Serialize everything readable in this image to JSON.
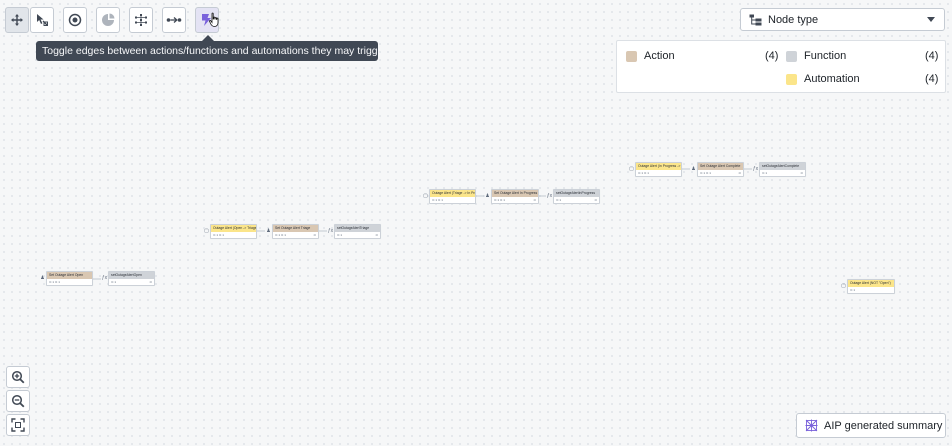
{
  "toolbar": {
    "tooltip": "Toggle edges between actions/functions and automations they may trigger"
  },
  "node_type_dropdown": {
    "label": "Node type"
  },
  "legend": {
    "items": [
      {
        "label": "Action",
        "count": "(4)",
        "color": "#d9c7b2"
      },
      {
        "label": "Function",
        "count": "(4)",
        "color": "#cfd3d8"
      },
      {
        "label": "Automation",
        "count": "(4)",
        "color": "#fbe58a"
      }
    ]
  },
  "summary_button": {
    "label": "AIP generated summary"
  },
  "colors": {
    "action": "#d9c7b2",
    "function": "#cfd3d8",
    "automation": "#fbe58a",
    "accent_purple": "#7961db"
  },
  "graph": {
    "nodes": [
      {
        "id": "a1",
        "type": "action",
        "title": "Set Outage Alert Open",
        "body_left": "⊙ 1  ⊙ 1",
        "body_right": ""
      },
      {
        "id": "f1",
        "type": "function",
        "title": "setOutageAlertOpen",
        "body_left": "⊙ 1",
        "body_right": "⊙"
      },
      {
        "id": "m1",
        "type": "automation",
        "title": "Outage Alert (Open -> Triage)",
        "body_left": "⊙ 1  ⊙ 1",
        "body_right": ""
      },
      {
        "id": "a2",
        "type": "action",
        "title": "Set Outage Alert Triage",
        "body_left": "⊙ 1  ⊙ 1",
        "body_right": "⊙"
      },
      {
        "id": "f2",
        "type": "function",
        "title": "setOutageAlertTriage",
        "body_left": "⊙ 1",
        "body_right": "⊙"
      },
      {
        "id": "m2",
        "type": "automation",
        "title": "Outage Alert (Triage -> In Prog...",
        "body_left": "⊙ 1  ⊙ 1",
        "body_right": ""
      },
      {
        "id": "a3",
        "type": "action",
        "title": "Set Outage Alert In Progress",
        "body_left": "⊙ 1  ⊙ 1",
        "body_right": "⊙"
      },
      {
        "id": "f3",
        "type": "function",
        "title": "setOutageAlertInProgress",
        "body_left": "⊙ 1",
        "body_right": "⊙"
      },
      {
        "id": "m3",
        "type": "automation",
        "title": "Outage Alert (In Progress -> C...",
        "body_left": "⊙ 1  ⊙ 1",
        "body_right": ""
      },
      {
        "id": "a4",
        "type": "action",
        "title": "Set Outage Alert Complete",
        "body_left": "⊙ 1  ⊙ 1",
        "body_right": "⊙"
      },
      {
        "id": "f4",
        "type": "function",
        "title": "setOutageAlertComplete",
        "body_left": "⊙ 1",
        "body_right": "⊙"
      },
      {
        "id": "m4",
        "type": "automation",
        "title": "Outage Alert (NOT \"Open\")",
        "body_left": "⊙ 1",
        "body_right": ""
      }
    ]
  }
}
